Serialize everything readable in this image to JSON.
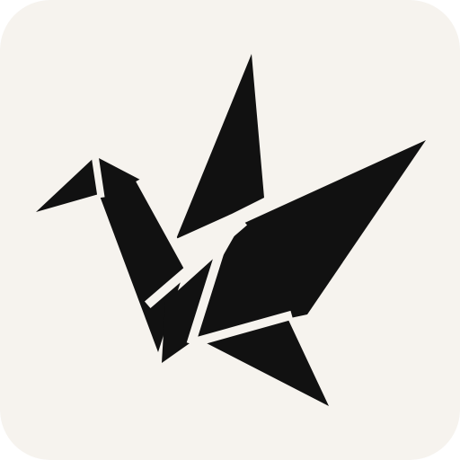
{
  "app_icon": {
    "name": "origami-crane-icon",
    "background_color": "#F6F3EE",
    "foreground_color": "#111111",
    "fold_line_color": "#F6F3EE"
  }
}
